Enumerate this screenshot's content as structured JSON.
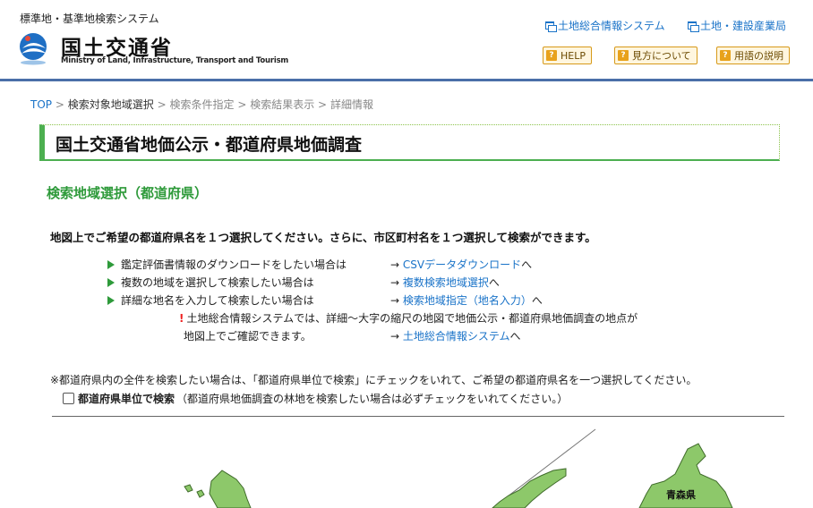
{
  "header": {
    "system_title": "標準地・基準地検索システム",
    "ministry_ja": "国土交通省",
    "ministry_en": "Ministry of Land, Infrastructure, Transport and Tourism",
    "links": [
      "土地総合情報システム",
      "土地・建設産業局"
    ],
    "buttons": [
      "HELP",
      "見方について",
      "用語の説明"
    ],
    "button_icon": "?"
  },
  "breadcrumb": {
    "items": [
      "TOP",
      "検索対象地域選択",
      "検索条件指定",
      "検索結果表示",
      "詳細情報"
    ],
    "separator": ">"
  },
  "page_title": "国土交通省地価公示・都道府県地価調査",
  "section_title": "検索地域選択（都道府県）",
  "intro": "地図上でご希望の都道府県名を１つ選択してください。さらに、市区町村名を１つ選択して検索ができます。",
  "options": [
    {
      "text": "鑑定評価書情報のダウンロードをしたい場合は",
      "arrow": "→",
      "link": "CSVデータダウンロード",
      "suffix": "へ"
    },
    {
      "text": "複数の地域を選択して検索したい場合は",
      "arrow": "→",
      "link": "複数検索地域選択",
      "suffix": "へ"
    },
    {
      "text": "詳細な地名を入力して検索したい場合は",
      "arrow": "→",
      "link": "検索地域指定（地名入力）",
      "suffix": "へ"
    }
  ],
  "note": {
    "mark": "!",
    "line1": "土地総合情報システムでは、詳細～大字の縮尺の地図で地価公示・都道府県地価調査の地点が",
    "line2": "地図上でご確認できます。",
    "arrow": "→",
    "link": "土地総合情報システム",
    "suffix": "へ"
  },
  "remark": "※都道府県内の全件を検索したい場合は、「都道府県単位で検索」にチェックをいれて、ご希望の都道府県名を一つ選択してください。",
  "checkbox": {
    "label": "都道府県単位で検索",
    "hint": "（都道府県地価調査の林地を検索したい場合は必ずチェックをいれてください。）",
    "checked": false
  },
  "map": {
    "visible_label": "青森県",
    "land_color": "#8dc86a",
    "border_color": "#3f6b2a"
  },
  "colors": {
    "link": "#1a73c8",
    "accent_green": "#2e9a3a",
    "header_rule": "#4a6fa8",
    "button_border": "#d79a1a"
  }
}
